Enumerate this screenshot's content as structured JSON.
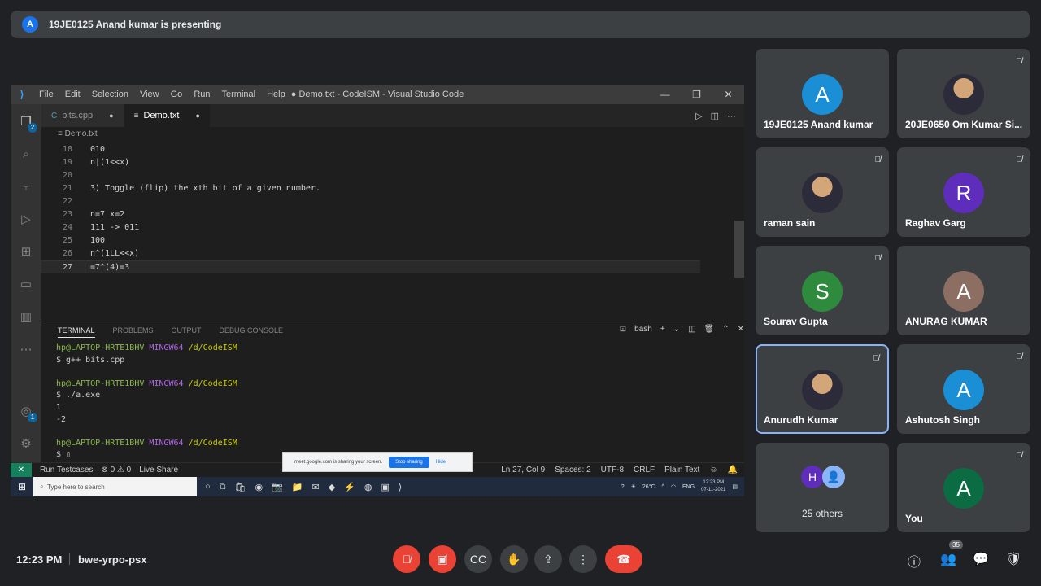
{
  "banner": {
    "avatar": "A",
    "text": "19JE0125 Anand kumar is presenting"
  },
  "vscode": {
    "menu": [
      "File",
      "Edit",
      "Selection",
      "View",
      "Go",
      "Run",
      "Terminal",
      "Help"
    ],
    "title": "● Demo.txt - CodeISM - Visual Studio Code",
    "tabs": [
      {
        "label": "bits.cpp",
        "icon": "C"
      },
      {
        "label": "Demo.txt",
        "icon": "≡"
      }
    ],
    "breadcrumb": "Demo.txt",
    "explorer_badge": "2",
    "accounts_badge": "1",
    "lines": [
      {
        "n": "18",
        "text": "010"
      },
      {
        "n": "19",
        "text": "n|(1<<x)"
      },
      {
        "n": "20",
        "text": ""
      },
      {
        "n": "21",
        "text": "3) Toggle (flip) the xth bit of a given number."
      },
      {
        "n": "22",
        "text": ""
      },
      {
        "n": "23",
        "text": "n=7 x=2"
      },
      {
        "n": "24",
        "text": "111 -> 011"
      },
      {
        "n": "25",
        "text": "100"
      },
      {
        "n": "26",
        "text": "n^(1LL<<x)"
      },
      {
        "n": "27",
        "text": "=7^(4)=3"
      }
    ],
    "panel_tabs": [
      "TERMINAL",
      "PROBLEMS",
      "OUTPUT",
      "DEBUG CONSOLE"
    ],
    "shell": "bash",
    "terminal": {
      "user": "hp@LAPTOP-HRTE1BHV",
      "mingw": "MINGW64",
      "dir": "/d/CodeISM",
      "cmd1": "$ g++ bits.cpp",
      "cmd2": "$ ./a.exe",
      "out1": "1",
      "out2": "-2",
      "prompt": "$ "
    },
    "status": {
      "run_testcases": "Run Testcases",
      "errors": "⊗ 0 ⚠ 0",
      "live_share": "Live Share",
      "position": "Ln 27, Col 9",
      "spaces": "Spaces: 2",
      "encoding": "UTF-8",
      "eol": "CRLF",
      "language": "Plain Text"
    },
    "sharebar": {
      "text": "meet.google.com is sharing your screen.",
      "stop": "Stop sharing",
      "hide": "Hide"
    },
    "taskbar": {
      "search_placeholder": "Type here to search",
      "weather": "26°C",
      "lang": "ENG",
      "time": "12:23 PM",
      "date": "07-11-2021"
    }
  },
  "participants": [
    {
      "name": "19JE0125 Anand kumar",
      "initial": "A",
      "color": "#1a8fd6",
      "muted": false,
      "photo": false
    },
    {
      "name": "20JE0650 Om Kumar Si...",
      "initial": "",
      "color": "#5a4a3a",
      "muted": true,
      "photo": true
    },
    {
      "name": "raman sain",
      "initial": "",
      "color": "#5a4a3a",
      "muted": true,
      "photo": true
    },
    {
      "name": "Raghav Garg",
      "initial": "R",
      "color": "#5f2dbb",
      "muted": true,
      "photo": false
    },
    {
      "name": "Sourav Gupta",
      "initial": "S",
      "color": "#2e8b3e",
      "muted": true,
      "photo": false
    },
    {
      "name": "ANURAG KUMAR",
      "initial": "A",
      "color": "#8d6e63",
      "muted": true,
      "photo": false
    },
    {
      "name": "Anurudh Kumar",
      "initial": "",
      "color": "#5a4a3a",
      "muted": true,
      "photo": true
    },
    {
      "name": "Ashutosh Singh",
      "initial": "A",
      "color": "#1a8fd6",
      "muted": true,
      "photo": false
    },
    {
      "name": "You",
      "initial": "A",
      "color": "#0b6b43",
      "muted": true,
      "photo": false
    }
  ],
  "others": {
    "label": "25 others",
    "initial": "H"
  },
  "bottom": {
    "time": "12:23 PM",
    "meeting_code": "bwe-yrpo-psx",
    "participant_count": "35"
  }
}
